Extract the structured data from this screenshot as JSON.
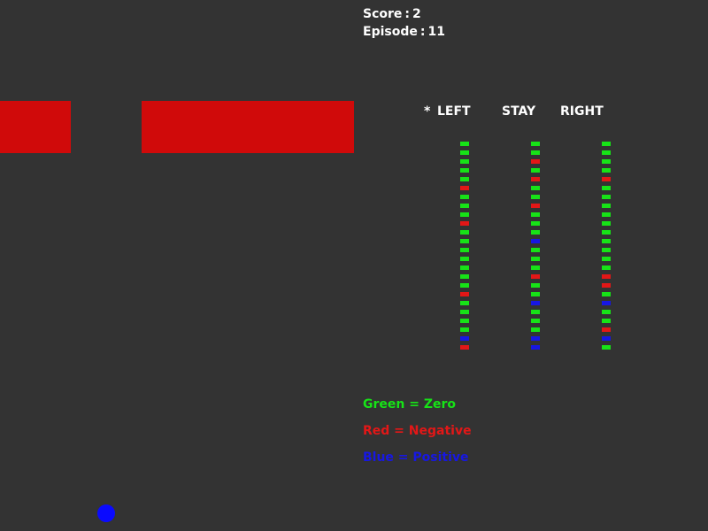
{
  "hud": {
    "score_label": "Score",
    "score_value": "2",
    "episode_label": "Episode",
    "episode_value": "11",
    "separator": ":"
  },
  "actions": {
    "selected_marker": "*",
    "selected_action": "LEFT",
    "left_label": "LEFT",
    "stay_label": "STAY",
    "right_label": "RIGHT"
  },
  "q_values": {
    "left": [
      "G",
      "G",
      "G",
      "G",
      "G",
      "R",
      "G",
      "G",
      "G",
      "R",
      "G",
      "G",
      "G",
      "G",
      "G",
      "G",
      "G",
      "R",
      "G",
      "G",
      "G",
      "G",
      "B",
      "R"
    ],
    "stay": [
      "G",
      "G",
      "R",
      "G",
      "R",
      "G",
      "G",
      "R",
      "G",
      "G",
      "G",
      "B",
      "G",
      "G",
      "G",
      "R",
      "G",
      "G",
      "B",
      "G",
      "G",
      "G",
      "B",
      "B"
    ],
    "right": [
      "G",
      "G",
      "G",
      "G",
      "R",
      "G",
      "G",
      "G",
      "G",
      "G",
      "G",
      "G",
      "G",
      "G",
      "G",
      "R",
      "R",
      "G",
      "B",
      "G",
      "G",
      "R",
      "B",
      "G"
    ]
  },
  "legend": {
    "green": "Green = Zero",
    "red": "Red = Negative",
    "blue": "Blue = Positive"
  },
  "colors": {
    "background": "#333333",
    "wall": "#d00a0a",
    "ball": "#0a0aff",
    "zero": "#17e317",
    "negative": "#e31717",
    "positive": "#1717e3",
    "hud_text": "#ffffff"
  }
}
